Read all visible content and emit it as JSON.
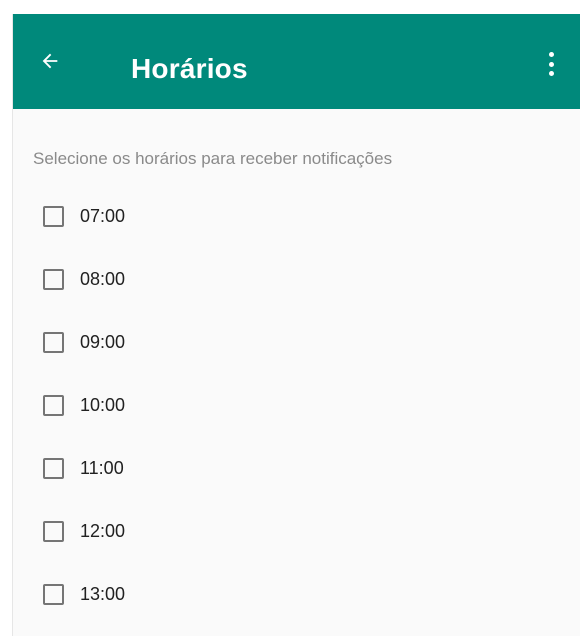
{
  "app_bar": {
    "title": "Horários",
    "back_icon": "arrow-left-icon",
    "overflow_icon": "more-vertical-icon",
    "color": "#00897b"
  },
  "subtitle": "Selecione os horários para receber notificações",
  "hours": [
    {
      "label": "07:00",
      "checked": false
    },
    {
      "label": "08:00",
      "checked": false
    },
    {
      "label": "09:00",
      "checked": false
    },
    {
      "label": "10:00",
      "checked": false
    },
    {
      "label": "11:00",
      "checked": false
    },
    {
      "label": "12:00",
      "checked": false
    },
    {
      "label": "13:00",
      "checked": false
    }
  ]
}
